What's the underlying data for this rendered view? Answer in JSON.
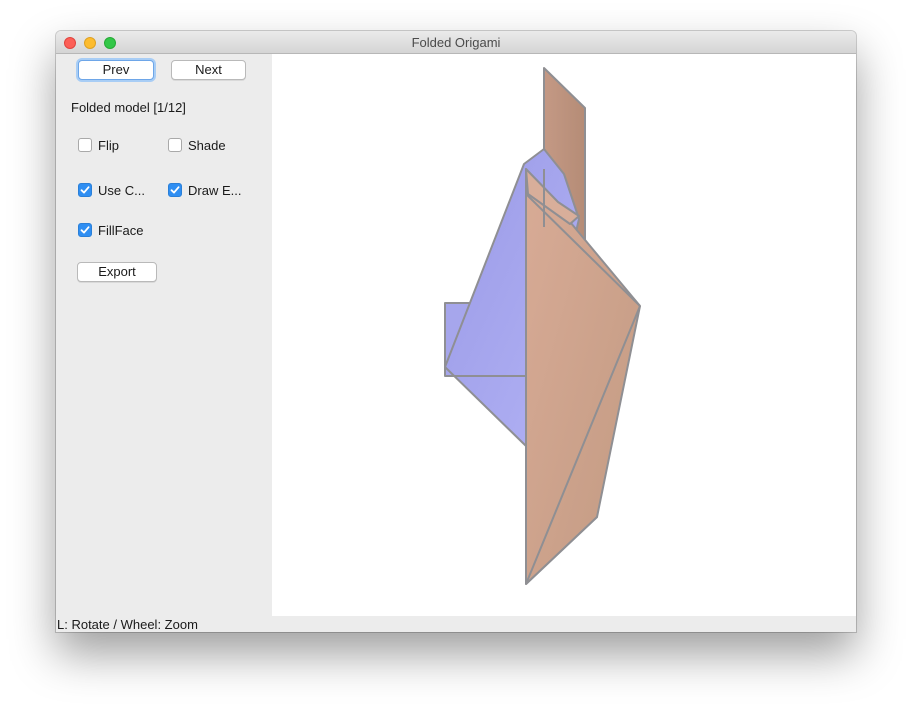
{
  "window": {
    "title": "Folded Origami"
  },
  "controls": {
    "prev_label": "Prev",
    "next_label": "Next",
    "model_status": "Folded model [1/12]",
    "export_label": "Export"
  },
  "options": {
    "flip": {
      "label": "Flip",
      "checked": false
    },
    "shade": {
      "label": "Shade",
      "checked": false
    },
    "use_color": {
      "label": "Use C...",
      "checked": true
    },
    "draw_edges": {
      "label": "Draw E...",
      "checked": true
    },
    "fill_face": {
      "label": "FillFace",
      "checked": true
    }
  },
  "statusbar": {
    "text": "L: Rotate / Wheel: Zoom"
  },
  "colors": {
    "accent": "#2f8ef2",
    "face_front": "#d4a690",
    "face_back": "#a6a6ec",
    "edge": "#8f8f93"
  }
}
